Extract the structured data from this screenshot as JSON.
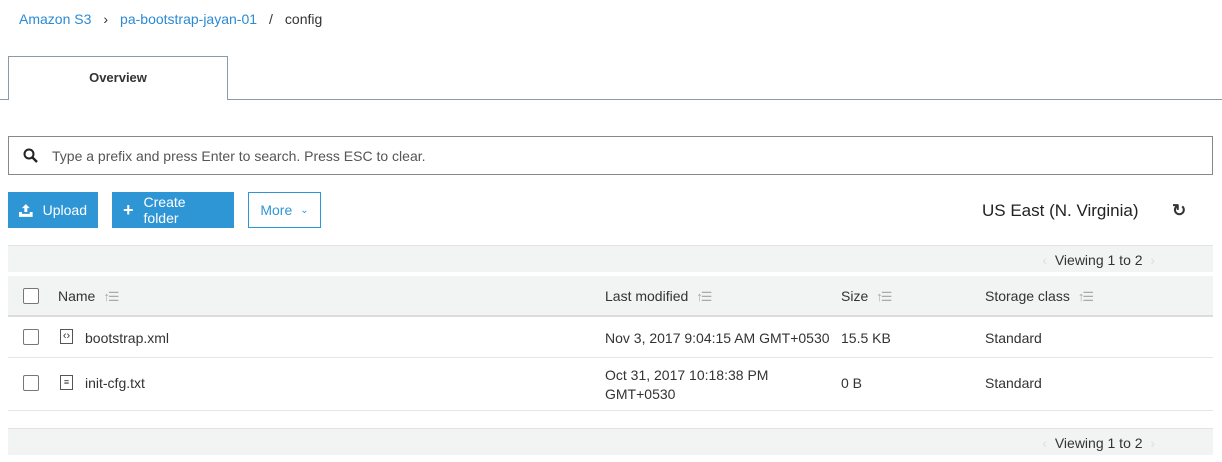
{
  "breadcrumb": {
    "root": "Amazon S3",
    "sep1": "›",
    "bucket": "pa-bootstrap-jayan-01",
    "sep2": "/",
    "folder": "config"
  },
  "tabs": [
    {
      "label": "Overview",
      "active": true
    }
  ],
  "search": {
    "placeholder": "Type a prefix and press Enter to search. Press ESC to clear.",
    "icon": "search-icon"
  },
  "toolbar": {
    "upload": "Upload",
    "create_folder": "Create folder",
    "more": "More",
    "region": "US East (N. Virginia)",
    "refresh_icon": "refresh-icon"
  },
  "pagination": {
    "label": "Viewing 1 to 2",
    "prev": "‹",
    "next": "›"
  },
  "table": {
    "columns": [
      "Name",
      "Last modified",
      "Size",
      "Storage class"
    ],
    "rows": [
      {
        "name": "bootstrap.xml",
        "icon": "code-file-icon",
        "modified": "Nov 3, 2017 9:04:15 AM GMT+0530",
        "size": "15.5 KB",
        "storage": "Standard"
      },
      {
        "name": "init-cfg.txt",
        "icon": "text-file-icon",
        "modified": "Oct 31, 2017 10:18:38 PM GMT+0530",
        "size": "0 B",
        "storage": "Standard"
      }
    ]
  },
  "colors": {
    "accent": "#2f96d6",
    "link": "#2a8ad4"
  }
}
